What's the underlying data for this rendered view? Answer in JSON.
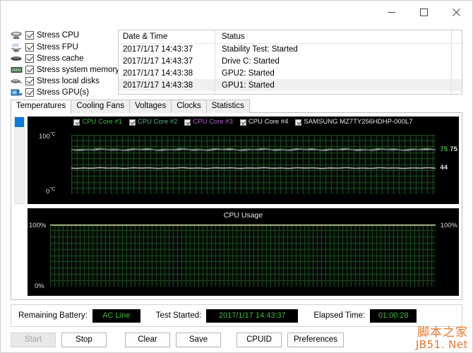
{
  "window": {
    "title": "",
    "controls": {
      "minimize": "minimize-icon",
      "maximize": "maximize-icon",
      "close": "close-icon"
    }
  },
  "stress_options": [
    {
      "label": "Stress CPU",
      "icon": "cpu-icon",
      "checked": true
    },
    {
      "label": "Stress FPU",
      "icon": "fpu-icon",
      "checked": true
    },
    {
      "label": "Stress cache",
      "icon": "cache-icon",
      "checked": true
    },
    {
      "label": "Stress system memory",
      "icon": "memory-icon",
      "checked": true
    },
    {
      "label": "Stress local disks",
      "icon": "disk-icon",
      "checked": true
    },
    {
      "label": "Stress GPU(s)",
      "icon": "gpu-icon",
      "checked": true
    }
  ],
  "status_table": {
    "columns": [
      "Date & Time",
      "Status"
    ],
    "rows": [
      {
        "time": "2017/1/17 14:43:37",
        "status": "Stability Test: Started"
      },
      {
        "time": "2017/1/17 14:43:37",
        "status": "Drive C: Started"
      },
      {
        "time": "2017/1/17 14:43:38",
        "status": "GPU2: Started"
      },
      {
        "time": "2017/1/17 14:43:38",
        "status": "GPU1: Started"
      }
    ]
  },
  "tabs": [
    {
      "label": "Temperatures",
      "active": true
    },
    {
      "label": "Cooling Fans",
      "active": false
    },
    {
      "label": "Voltages",
      "active": false
    },
    {
      "label": "Clocks",
      "active": false
    },
    {
      "label": "Statistics",
      "active": false
    }
  ],
  "chart_data": [
    {
      "type": "line",
      "name": "temperatures-chart",
      "title": "",
      "ylabel_top": "100",
      "ylabel_top_unit": "°C",
      "ylabel_bottom": "0",
      "ylabel_bottom_unit": "°C",
      "ylim": [
        0,
        100
      ],
      "grid": true,
      "background": "#040904",
      "gridcolor": "#1d4d1d",
      "legend_position": "top-center",
      "legend": [
        {
          "label": "CPU Core #1",
          "color": "#3fbd3f",
          "checked": true
        },
        {
          "label": "CPU Core #2",
          "color": "#49b88a",
          "checked": true
        },
        {
          "label": "CPU Core #3",
          "color": "#b364c8",
          "checked": true
        },
        {
          "label": "CPU Core #4",
          "color": "#e4e4e4",
          "checked": true
        },
        {
          "label": "SAMSUNG MZ7TY256HDHP-000L7",
          "color": "#e4e4e4",
          "checked": true
        }
      ],
      "series": [
        {
          "name": "CPU Core #1",
          "color": "#3fbd3f",
          "value": 75,
          "current_label": "75"
        },
        {
          "name": "CPU Core #2",
          "color": "#49b88a",
          "value": 75,
          "current_label": "75"
        },
        {
          "name": "CPU Core #3",
          "color": "#b364c8",
          "value": 75,
          "current_label": ""
        },
        {
          "name": "CPU Core #4",
          "color": "#e4e4e4",
          "value": 75,
          "current_label": "75"
        },
        {
          "name": "SAMSUNG MZ7TY256HDHP-000L7",
          "color": "#e4e4e4",
          "value": 44,
          "current_label": "44"
        }
      ],
      "value_tags": [
        {
          "text": "75",
          "color": "#3fbd3f",
          "value": 75
        },
        {
          "text": "75",
          "color": "#e4e4e4",
          "value": 75
        },
        {
          "text": "44",
          "color": "#e4e4e4",
          "value": 44
        }
      ]
    },
    {
      "type": "line",
      "name": "cpu-usage-chart",
      "title": "CPU Usage",
      "ylabel_top": "100%",
      "ylabel_top_right": "100%",
      "ylabel_bottom": "0%",
      "ylim": [
        0,
        100
      ],
      "grid": true,
      "background": "#040904",
      "gridcolor": "#1d4d1d",
      "series": [
        {
          "name": "CPU Usage",
          "color": "#d6e4a8",
          "value": 100
        }
      ]
    }
  ],
  "statusbar": {
    "battery_label": "Remaining Battery:",
    "battery_value": "AC Line",
    "test_started_label": "Test Started:",
    "test_started_value": "2017/1/17 14:43:37",
    "elapsed_label": "Elapsed Time:",
    "elapsed_value": "01:00:28"
  },
  "buttons": [
    {
      "label": "Start",
      "disabled": true
    },
    {
      "label": "Stop",
      "disabled": false
    },
    {
      "label": "Clear",
      "disabled": false
    },
    {
      "label": "Save",
      "disabled": false
    },
    {
      "label": "CPUID",
      "disabled": false
    },
    {
      "label": "Preferences",
      "disabled": false
    }
  ],
  "watermark": {
    "line1": "脚本之家",
    "line2": "JB51. Net"
  }
}
